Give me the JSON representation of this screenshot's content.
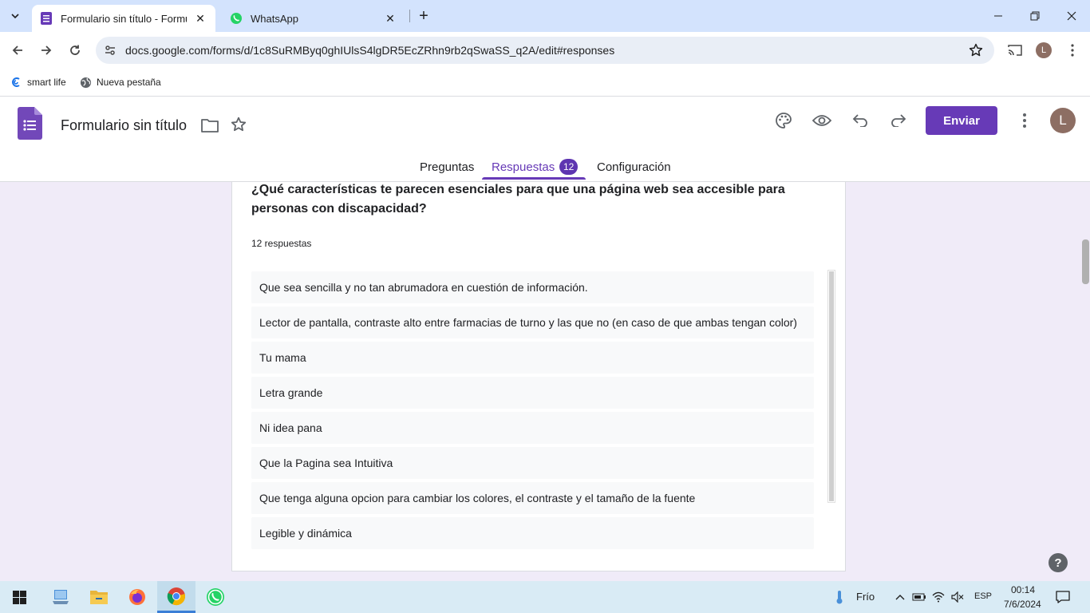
{
  "browser": {
    "tabs": [
      {
        "title": "Formulario sin título - Formular",
        "icon": "google-forms-icon",
        "active": true
      },
      {
        "title": "WhatsApp",
        "icon": "whatsapp-icon",
        "active": false
      }
    ],
    "url": "docs.google.com/forms/d/1c8SuRMByq0ghIUlsS4lgDR5EcZRhn9rb2qSwaSS_q2A/edit#responses",
    "profile_initial": "L",
    "bookmarks": [
      {
        "label": "smart life",
        "icon": "smart-life-icon"
      },
      {
        "label": "Nueva pestaña",
        "icon": "globe-icon"
      }
    ]
  },
  "forms": {
    "title": "Formulario sin título",
    "send_label": "Enviar",
    "avatar_initial": "L",
    "tabs": {
      "questions": "Preguntas",
      "responses": "Respuestas",
      "responses_count": "12",
      "settings": "Configuración"
    },
    "accent": "#673ab7"
  },
  "question": {
    "title": "¿Qué características te parecen esenciales para que una página web sea accesible para personas con discapacidad?",
    "response_count": "12 respuestas",
    "responses": [
      "Que sea sencilla y no tan abrumadora en cuestión de información.",
      "Lector de pantalla, contraste alto entre farmacias de turno y las que no (en caso de que ambas tengan color)",
      "Tu mama",
      "Letra grande",
      "Ni idea pana",
      "Que la Pagina sea Intuitiva",
      "Que tenga alguna opcion para cambiar los colores, el contraste y el tamaño de la fuente",
      "Legible y dinámica"
    ]
  },
  "taskbar": {
    "weather": "Frío",
    "language": "ESP",
    "time": "00:14",
    "date": "7/6/2024"
  }
}
